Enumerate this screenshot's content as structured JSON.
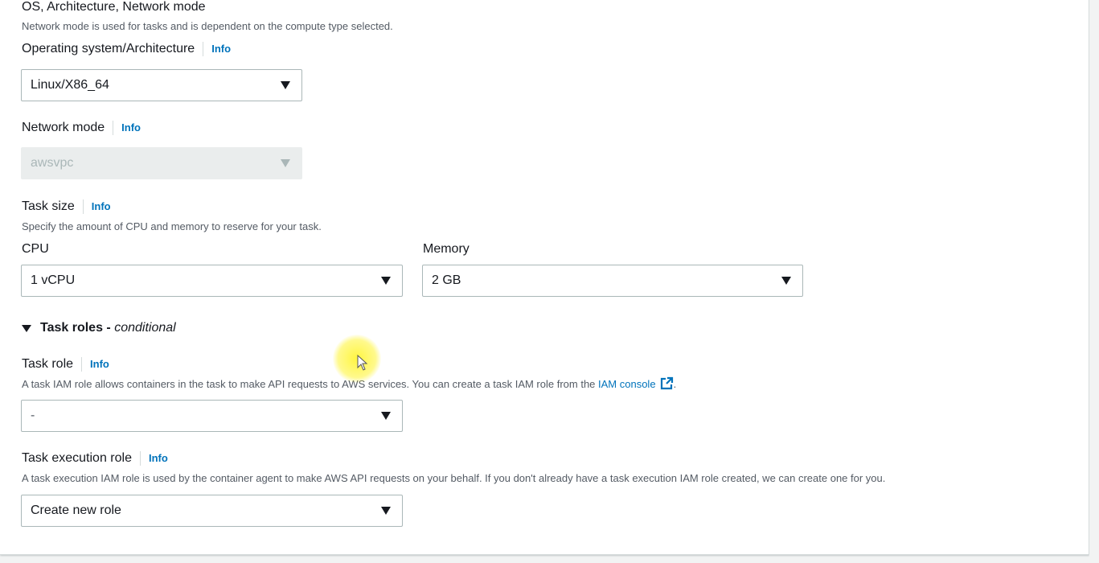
{
  "section": {
    "title": "OS, Architecture, Network mode",
    "description": "Network mode is used for tasks and is dependent on the compute type selected."
  },
  "os_arch": {
    "label": "Operating system/Architecture",
    "info": "Info",
    "value": "Linux/X86_64"
  },
  "network_mode": {
    "label": "Network mode",
    "info": "Info",
    "value": "awsvpc"
  },
  "task_size": {
    "label": "Task size",
    "info": "Info",
    "description": "Specify the amount of CPU and memory to reserve for your task.",
    "cpu_label": "CPU",
    "cpu_value": "1 vCPU",
    "memory_label": "Memory",
    "memory_value": "2 GB"
  },
  "task_roles": {
    "title": "Task roles - ",
    "title_suffix": "conditional"
  },
  "task_role": {
    "label": "Task role",
    "info": "Info",
    "description": "A task IAM role allows containers in the task to make API requests to AWS services. You can create a task IAM role from the ",
    "link_text": "IAM console",
    "description_end": ".",
    "value": "-"
  },
  "task_execution_role": {
    "label": "Task execution role",
    "info": "Info",
    "description": "A task execution IAM role is used by the container agent to make AWS API requests on your behalf. If you don't already have a task execution IAM role created, we can create one for you.",
    "value": "Create new role"
  },
  "colors": {
    "link": "#0073bb",
    "text": "#16191f",
    "secondary_text": "#545b64",
    "border": "#aab7b8"
  }
}
